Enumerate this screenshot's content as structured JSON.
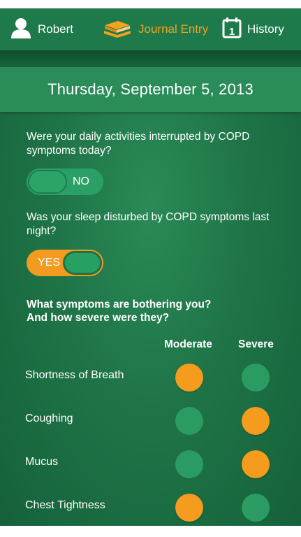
{
  "nav": {
    "user_label": "Robert",
    "journal_label": "Journal Entry",
    "history_label": "History",
    "calendar_day": "1",
    "active_color": "#f4a21f"
  },
  "date": "Thursday, September 5, 2013",
  "questions": [
    {
      "text": "Were your daily activities interrupted by COPD symptoms today?",
      "toggle": "NO"
    },
    {
      "text": "Was your sleep disturbed by COPD symptoms last night?",
      "toggle": "YES"
    }
  ],
  "symptoms": {
    "title_line1": "What symptoms are bothering you?",
    "title_line2": "And how severe were they?",
    "columns": [
      "Moderate",
      "Severe"
    ],
    "rows": [
      {
        "label": "Shortness of Breath",
        "selected": "Moderate"
      },
      {
        "label": "Coughing",
        "selected": "Severe"
      },
      {
        "label": "Mucus",
        "selected": "Severe"
      },
      {
        "label": "Chest Tightness",
        "selected": "Moderate"
      }
    ]
  },
  "colors": {
    "selected": "#f59c1f",
    "unselected": "#2a9c63",
    "background": "#1f7447"
  }
}
